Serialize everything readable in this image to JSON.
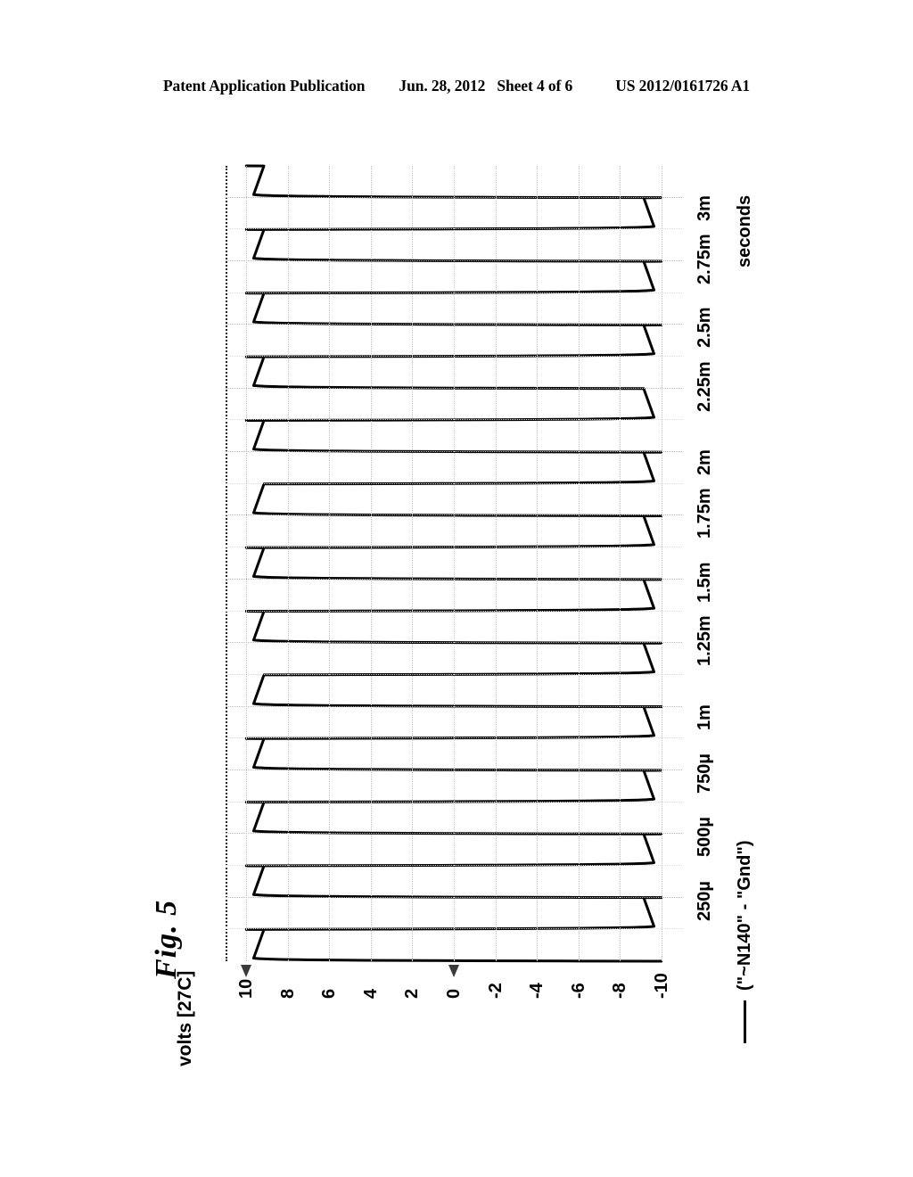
{
  "header": {
    "publication": "Patent Application Publication",
    "date": "Jun. 28, 2012",
    "sheet": "Sheet 4 of 6",
    "doc_number": "US 2012/0161726 A1"
  },
  "figure": {
    "label": "Fig. 5"
  },
  "legend": {
    "marker": "solid-line",
    "text": "(\"~N140\" - \"Gnd\")"
  },
  "chart_data": {
    "type": "line",
    "title": "",
    "xlabel": "seconds",
    "ylabel": "volts [27C]",
    "orientation": "rotated-90",
    "grid": true,
    "legend_position": "bottom",
    "xlim": [
      0,
      0.003125
    ],
    "ylim": [
      -11,
      11
    ],
    "x_tick_labels": [
      "250µ",
      "500µ",
      "750µ",
      "1m",
      "1.25m",
      "1.5m",
      "1.75m",
      "2m",
      "2.25m",
      "2.5m",
      "2.75m",
      "3m"
    ],
    "x_tick_values": [
      0.00025,
      0.0005,
      0.00075,
      0.001,
      0.00125,
      0.0015,
      0.00175,
      0.002,
      0.00225,
      0.0025,
      0.00275,
      0.003
    ],
    "y_tick_labels": [
      "10",
      "8",
      "6",
      "4",
      "2",
      "0",
      "-2",
      "-4",
      "-6",
      "-8",
      "-10"
    ],
    "y_tick_values": [
      10,
      8,
      6,
      4,
      2,
      0,
      -2,
      -4,
      -6,
      -8,
      -10
    ],
    "cursor_markers": [
      10,
      0
    ],
    "series": [
      {
        "name": "(\"~N140\" - \"Gnd\")",
        "color": "#000000",
        "waveform": "square",
        "period_seconds": 0.00025,
        "duty_cycle": 0.5,
        "high_value": 10,
        "low_value": -10,
        "rise_time_seconds": 1.2e-05,
        "fall_time_seconds": 1.2e-05,
        "pulse_count": 12,
        "pulse_start_times": [
          0.0,
          0.00025,
          0.0005,
          0.00075,
          0.001,
          0.00125,
          0.0015,
          0.00175,
          0.002,
          0.00225,
          0.0025,
          0.00275
        ],
        "description": "Square wave oscillating between +10 V and -10 V with a 250 microsecond period over a 3 millisecond window."
      }
    ]
  }
}
